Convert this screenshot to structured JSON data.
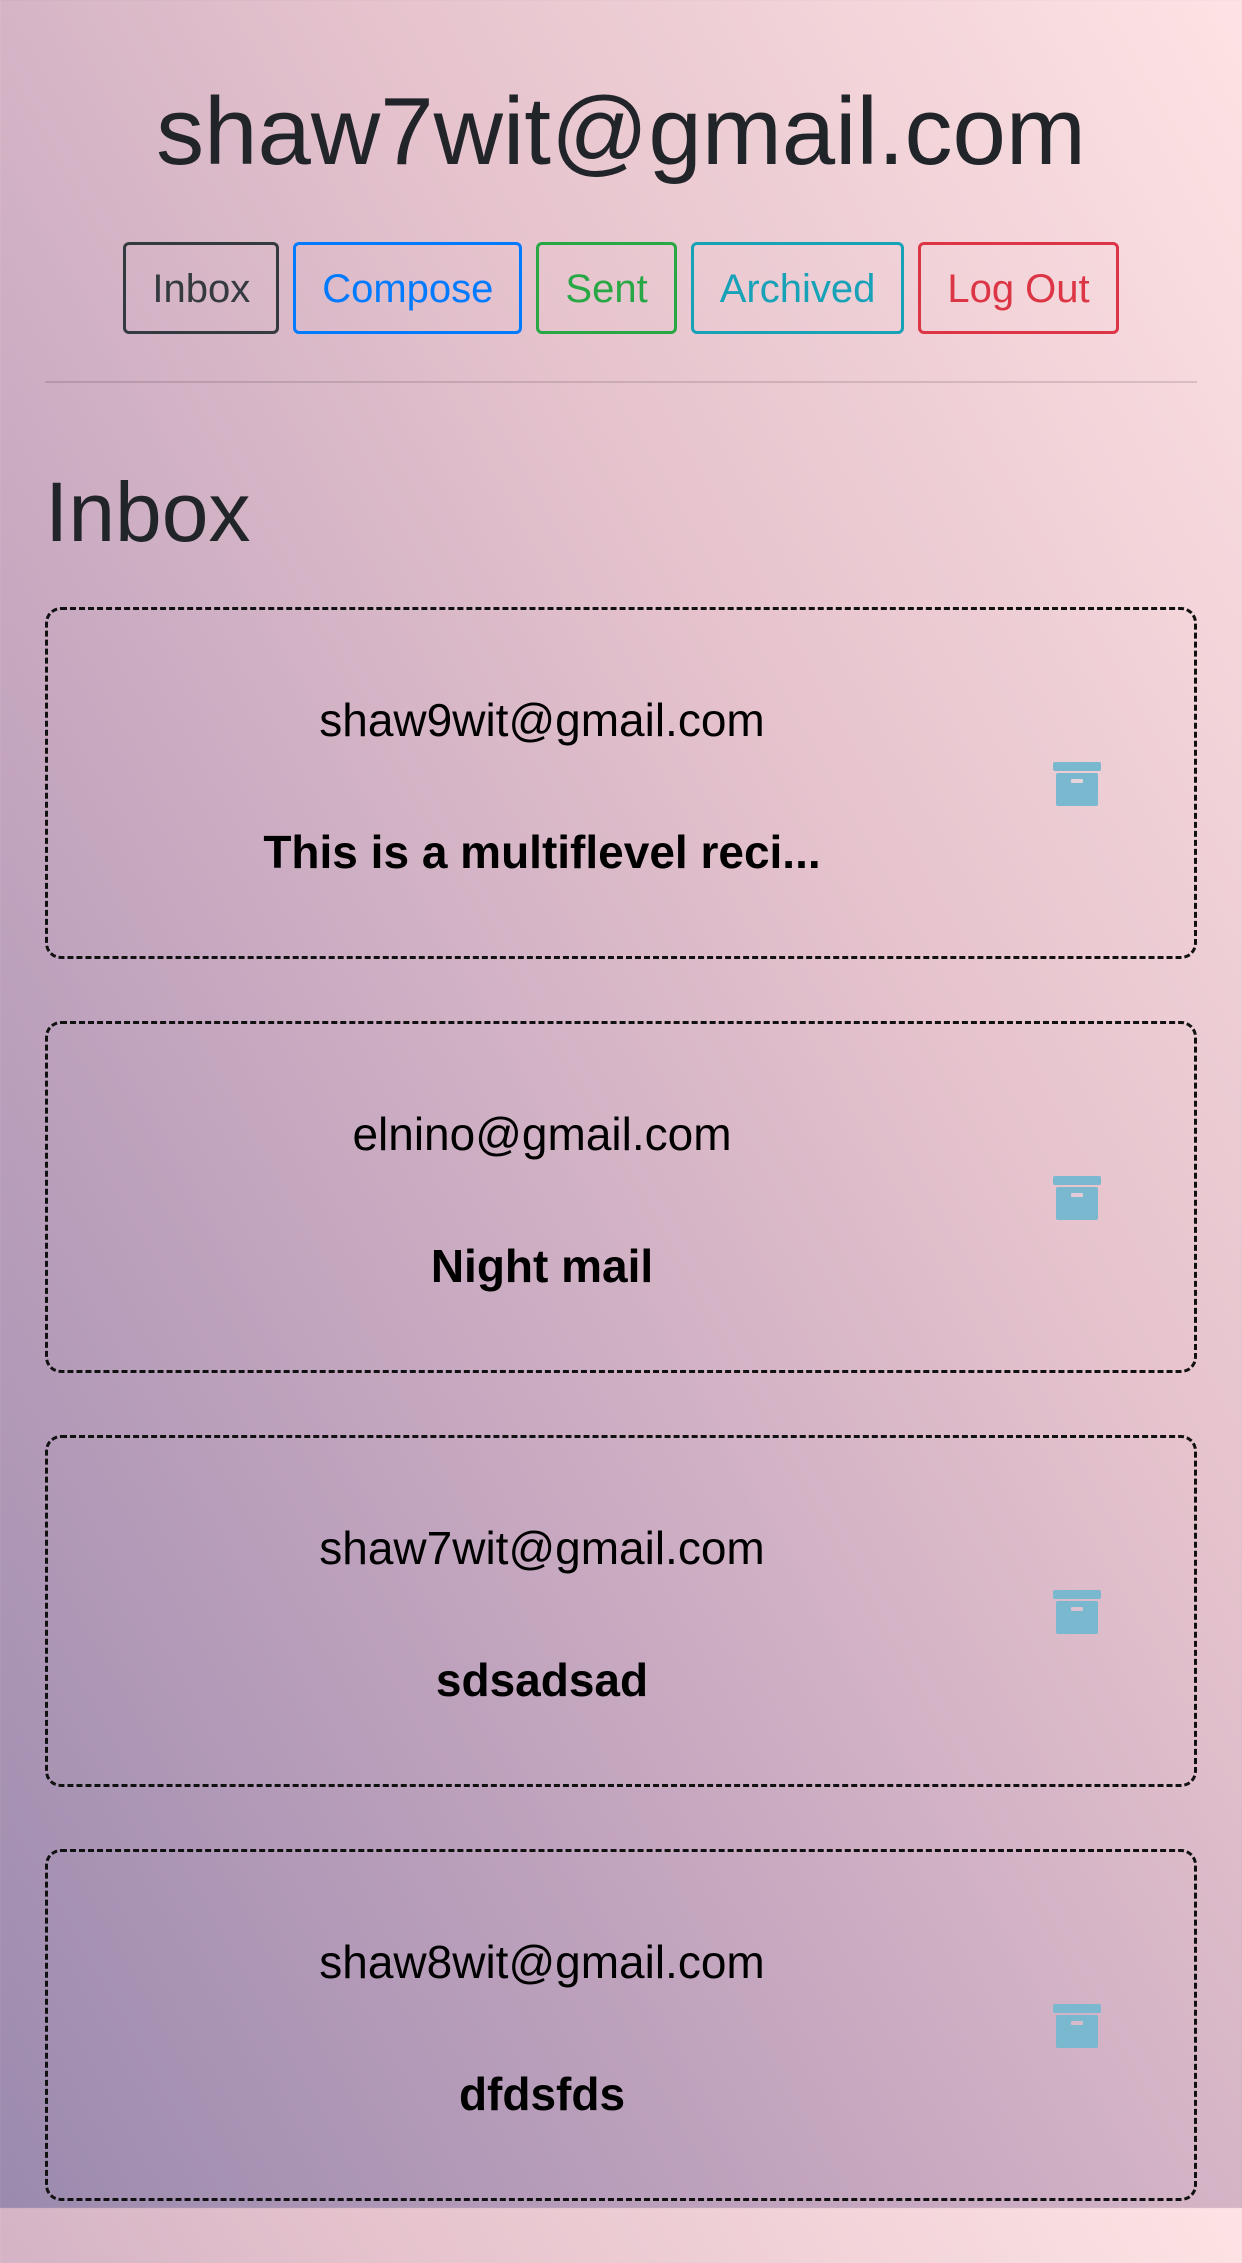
{
  "header": {
    "title": "shaw7wit@gmail.com"
  },
  "nav": {
    "inbox": "Inbox",
    "compose": "Compose",
    "sent": "Sent",
    "archived": "Archived",
    "logout": "Log Out"
  },
  "section": {
    "title": "Inbox"
  },
  "emails": [
    {
      "sender": "shaw9wit@gmail.com",
      "subject": "This is a multiflevel reci...",
      "icon": "archive-icon"
    },
    {
      "sender": "elnino@gmail.com",
      "subject": "Night mail",
      "icon": "archive-icon"
    },
    {
      "sender": "shaw7wit@gmail.com",
      "subject": "sdsadsad",
      "icon": "archive-icon"
    },
    {
      "sender": "shaw8wit@gmail.com",
      "subject": "dfdsfds",
      "icon": "archive-icon"
    }
  ],
  "colors": {
    "dark": "#343a40",
    "primary": "#007bff",
    "success": "#28a745",
    "info": "#17a2b8",
    "danger": "#dc3545",
    "archive_icon": "#7ab8cf"
  }
}
